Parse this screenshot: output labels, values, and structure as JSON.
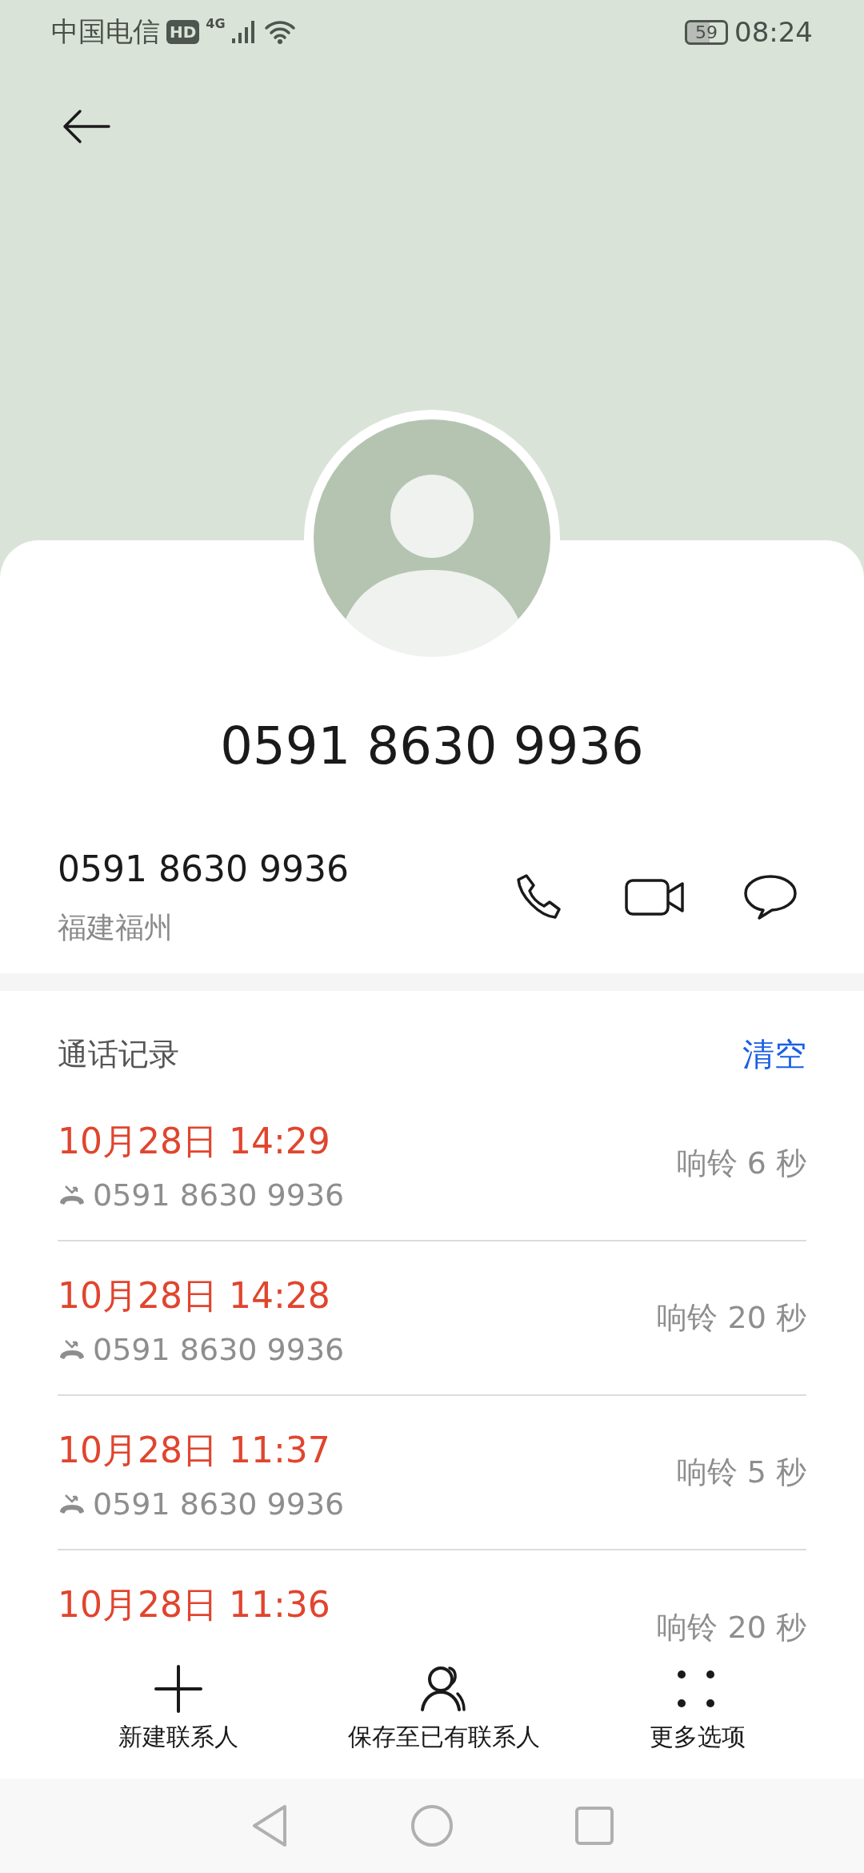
{
  "status_bar": {
    "carrier": "中国电信",
    "hd": "HD",
    "network": "4G",
    "battery": "59",
    "time": "08:24"
  },
  "contact": {
    "title": "0591 8630 9936",
    "number": "0591 8630 9936",
    "location": "福建福州"
  },
  "call_log": {
    "title": "通话记录",
    "clear": "清空",
    "rows": [
      {
        "kind": "missed",
        "time": "10月28日 14:29",
        "number": "0591 8630 9936",
        "duration": "响铃 6 秒"
      },
      {
        "kind": "missed",
        "time": "10月28日 14:28",
        "number": "0591 8630 9936",
        "duration": "响铃 20 秒"
      },
      {
        "kind": "missed",
        "time": "10月28日 11:37",
        "number": "0591 8630 9936",
        "duration": "响铃 5 秒"
      },
      {
        "kind": "missed",
        "time": "10月28日 11:36",
        "duration": "响铃 20 秒"
      }
    ]
  },
  "actions": [
    {
      "kind": "add",
      "label": "新建联系人"
    },
    {
      "kind": "save",
      "label": "保存至已有联系人"
    },
    {
      "kind": "more",
      "label": "更多选项"
    }
  ]
}
